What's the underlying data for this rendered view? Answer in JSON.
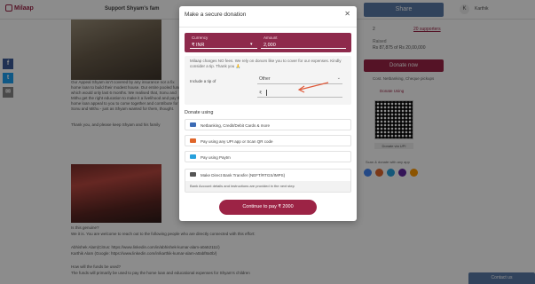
{
  "colors": {
    "brand": "#9c2345",
    "amount_box": "#8e2a4c",
    "share": "#5a7aa8"
  },
  "header": {
    "logo": "Milaap",
    "campaign": "Support Shyam's fam",
    "share_label": "Share",
    "avatar_initial": "K",
    "user_name": "Karthik"
  },
  "background": {
    "story_top": "Our Appeal Shyam isn't covered by any insurance nor a fix home loan to build their modest house. Our entire pooled funds which would only last 6 months. We realised that, Sonu and Mithu get the right education to make it a livelihood and pay the home loan appeal to you to come together and contribute for Sonu and Mithu - just as Shyam wanted for them, thought.",
    "thanks": "Thank you, and please keep Shyam and his family",
    "genuine_q": "Is this genuine?",
    "genuine_a": "We it is. You are welcome to reach out to the following people who are directly connected with this effort:",
    "contact1": "Abhishek Alam(Citrus: https://www.linkedin.com/in/abhishek-kumar-alam-a0a52111/)",
    "contact2": "Karthik Alam (Google: https://www.linkedin.com/in/karthik-kumar-alam-a0abf8a0b/)",
    "funds_q": "How will the funds be used?",
    "funds_a": "The funds will primarily be used to pay the home loan and educational expenses for Shyam's children",
    "supporters_count": "2",
    "supporters_link": "20 supporters",
    "raised_label": "Raised",
    "raised_amount": "Rs 87,875 of Rs 20,00,000",
    "donate_now": "Donate now",
    "cost_text": "Cost. Netbanking, Cheque pickups",
    "donate_link": "Donate Using",
    "qr_label": "Donate via UPI",
    "scan_text": "Scan & donate with any app",
    "contact_us": "Contact us"
  },
  "modal": {
    "title": "Make a secure donation",
    "close_icon": "close-icon",
    "currency_label": "Currency",
    "currency_value": "₹ INR",
    "amount_label": "Amount",
    "amount_value": "2,000",
    "tip_note": "Milaap charges NO fees. We rely on donors like you to cover for our expenses. Kindly consider a tip. Thank you 🙏",
    "tip_label": "Include a tip of",
    "tip_selected": "Other",
    "tip_currency_symbol": "₹",
    "donate_using": "Donate using",
    "pay_options": [
      {
        "label": "Netbanking, Credit/Debit Cards & more",
        "icon": "card-icon",
        "icon_color": "#3c6bb4"
      },
      {
        "label": "Pay using any UPI app or Scan QR code",
        "icon": "upi-icon",
        "icon_color": "#e0662a"
      },
      {
        "label": "Pay using Paytm",
        "icon": "paytm-icon",
        "icon_color": "#27a0dc"
      },
      {
        "label": "Make Direct Bank Transfer (NEFT/RTGS/IMPS)",
        "icon": "bank-icon",
        "icon_color": "#555555"
      }
    ],
    "bank_note": "Bank Account details and instructions are provided in the next step",
    "continue_label": "Continue to pay ₹ 2000"
  }
}
